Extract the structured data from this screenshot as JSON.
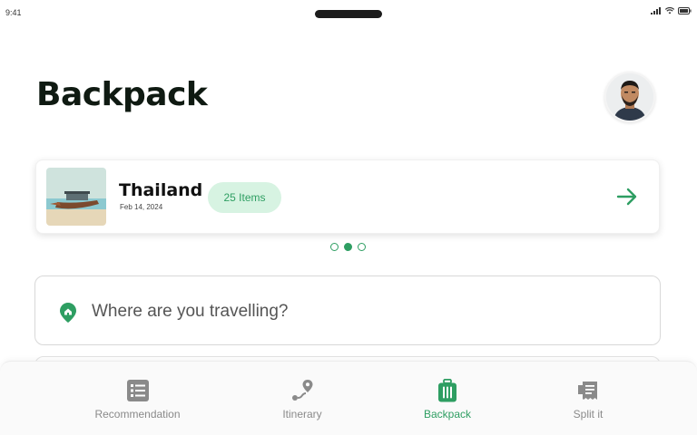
{
  "status_bar": {
    "time": "9:41"
  },
  "header": {
    "title": "Backpack"
  },
  "trip_card": {
    "name": "Thailand",
    "date": "Feb 14, 2024",
    "items_badge": "25 Items"
  },
  "carousel": {
    "pages": 3,
    "active_index": 1
  },
  "search": {
    "placeholder": "Where are you travelling?"
  },
  "tab_bar": {
    "tabs": [
      {
        "label": "Recommendation",
        "icon": "list-icon"
      },
      {
        "label": "Itinerary",
        "icon": "route-icon"
      },
      {
        "label": "Backpack",
        "icon": "luggage-icon"
      },
      {
        "label": "Split it",
        "icon": "receipt-icon"
      }
    ],
    "active_index": 2
  },
  "colors": {
    "accent": "#2e9e62",
    "badge_bg": "#d7f3e2",
    "inactive": "#8a8a8a"
  }
}
